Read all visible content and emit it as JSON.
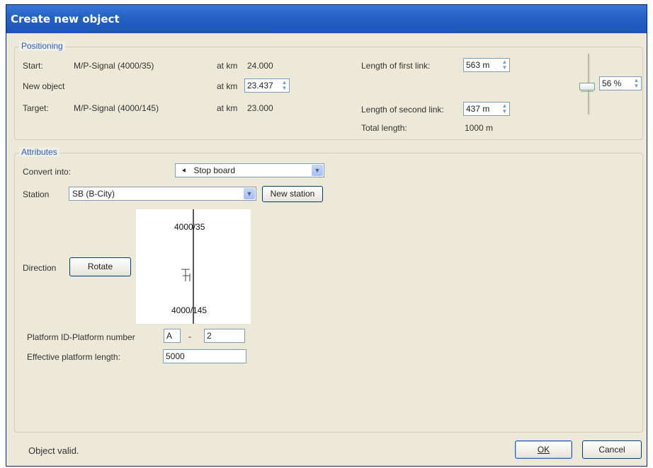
{
  "window": {
    "title": "Create new object"
  },
  "positioning": {
    "legend": "Positioning",
    "start_label": "Start:",
    "start_value": "M/P-Signal (4000/35)",
    "start_km_label": "at km",
    "start_km": "24.000",
    "new_object_label": "New object",
    "new_km_label": "at km",
    "new_km": "23.437",
    "target_label": "Target:",
    "target_value": "M/P-Signal (4000/145)",
    "target_km_label": "at km",
    "target_km": "23.000",
    "first_link_label": "Length of first link:",
    "first_link_value": "563 m",
    "second_link_label": "Length of second link:",
    "second_link_value": "437 m",
    "total_label": "Total length:",
    "total_value": "1000 m",
    "slider_value": "56 %",
    "slider_fraction": 0.56
  },
  "attributes": {
    "legend": "Attributes",
    "convert_label": "Convert into:",
    "convert_value": "Stop board",
    "convert_icon": "stop-board-icon",
    "station_label": "Station",
    "station_value": "SB (B-City)",
    "new_station_button": "New station",
    "direction_label": "Direction",
    "rotate_button": "Rotate",
    "diagram_top_label": "4000/35",
    "diagram_bottom_label": "4000/145",
    "platform_label": "Platform ID-Platform number",
    "platform_id": "A",
    "platform_sep": "-",
    "platform_number": "2",
    "effective_length_label": "Effective platform length:",
    "effective_length_value": "5000"
  },
  "footer": {
    "status": "Object valid.",
    "ok_button": "OK",
    "cancel_button": "Cancel"
  },
  "colors": {
    "titlebar": "#2463c4",
    "legend_text": "#2f5fbf",
    "dialog_bg": "#f0efe6"
  }
}
